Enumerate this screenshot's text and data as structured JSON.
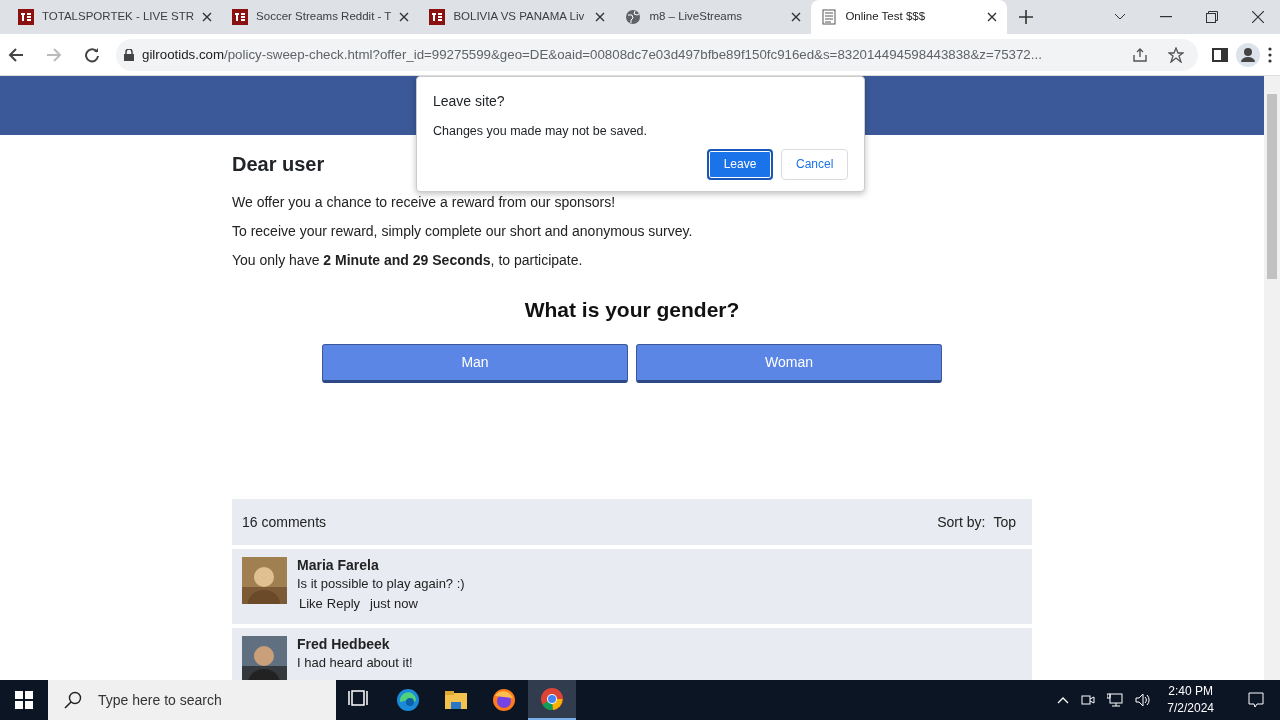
{
  "browser": {
    "tabs": [
      {
        "title": "TOTALSPORTEK - LIVE STR",
        "kind": "ts",
        "selected": false
      },
      {
        "title": "Soccer Streams Reddit - T",
        "kind": "ts",
        "selected": false
      },
      {
        "title": "BOLIVIA VS PANAMA Liv",
        "kind": "ts",
        "selected": false
      },
      {
        "title": "m8 – LiveStreams",
        "kind": "globe",
        "selected": false
      },
      {
        "title": "Online Test $$$",
        "kind": "doc",
        "selected": true
      }
    ],
    "url": {
      "domain": "gilrootids.com",
      "path": "/policy-sweep-check.html?offer_id=99275599&geo=DE&oaid=00808dc7e03d497bfbe89f150fc916ed&s=832014494598443838&z=75372..."
    }
  },
  "dialog": {
    "title": "Leave site?",
    "message": "Changes you made may not be saved.",
    "buttons": [
      {
        "label": "Leave",
        "primary": true
      },
      {
        "label": "Cancel",
        "primary": false
      }
    ]
  },
  "page": {
    "heading": "Dear user",
    "paragraphs": [
      "We offer you a chance to receive a reward from our sponsors!",
      "To receive your reward, simply complete our short and anonymous survey.",
      "You only have **2 Minute and 29 Seconds**, to participate."
    ],
    "question": "What is your gender?",
    "answers": [
      "Man",
      "Woman"
    ],
    "comments_header": {
      "count": "16 comments",
      "sort_label": "Sort by:",
      "sort_value": "Top"
    },
    "comments": [
      {
        "author": "Maria Farela",
        "text": "Is it possible to play again? :)",
        "actions": [
          "Like",
          "Reply"
        ],
        "time": "just now"
      },
      {
        "author": "Fred Hedbeek",
        "text": "I had heard about it!"
      }
    ]
  },
  "taskbar": {
    "search_placeholder": "Type here to search",
    "apps": [
      {
        "kind": "taskview",
        "active": false
      },
      {
        "kind": "edge",
        "active": false
      },
      {
        "kind": "files",
        "active": false
      },
      {
        "kind": "firefox",
        "active": false
      },
      {
        "kind": "chrome",
        "active": true
      }
    ],
    "time": "2:40 PM",
    "date": "7/2/2024"
  }
}
